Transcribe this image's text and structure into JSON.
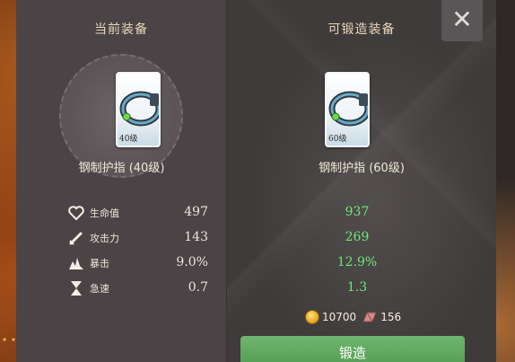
{
  "close_label": "✕",
  "current": {
    "title": "当前装备",
    "item_name": "钢制护指 (40级)",
    "card_level": "40级",
    "stats": [
      {
        "label": "生命值",
        "value": "497",
        "icon": "heart-icon"
      },
      {
        "label": "攻击力",
        "value": "143",
        "icon": "sword-icon"
      },
      {
        "label": "暴击",
        "value": "9.0%",
        "icon": "critical-icon"
      },
      {
        "label": "急速",
        "value": "0.7",
        "icon": "hourglass-icon"
      }
    ]
  },
  "forgeable": {
    "title": "可锻造装备",
    "item_name": "钢制护指 (60级)",
    "card_level": "60级",
    "values": [
      "937",
      "269",
      "12.9%",
      "1.3"
    ]
  },
  "cost": {
    "gold": "10700",
    "gold_icon": "gold-coin-icon",
    "material": "156",
    "material_icon": "ingot-icon"
  },
  "forge_button": "锻造",
  "colors": {
    "accent_green": "#6ee57a",
    "button_green": "#5aa55a",
    "title_text": "#e8d8b8"
  }
}
